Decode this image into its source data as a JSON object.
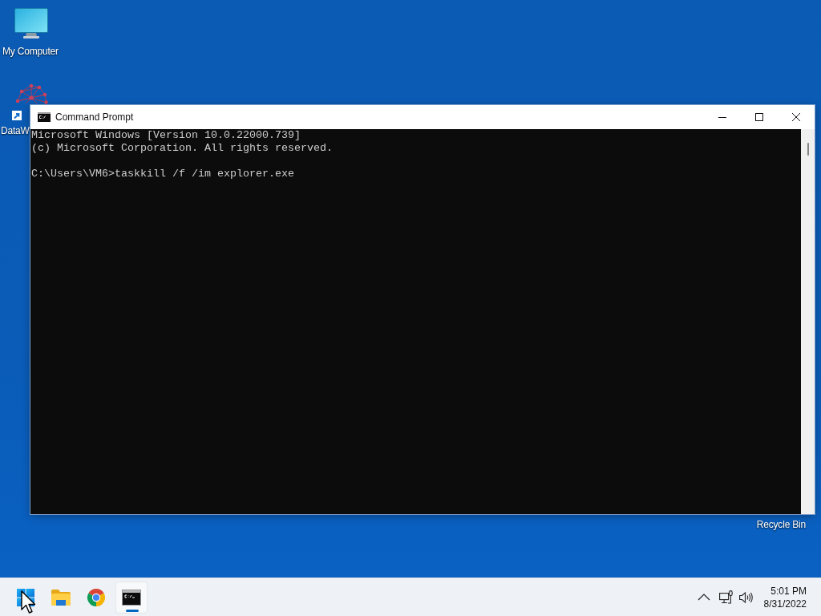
{
  "desktop": {
    "icons": [
      {
        "label": "My Computer",
        "kind": "computer",
        "shortcut": false
      },
      {
        "label": "DataW",
        "kind": "app",
        "shortcut": true
      }
    ],
    "recycle_bin": {
      "label": "Recycle Bin"
    }
  },
  "window": {
    "title": "Command Prompt",
    "console": {
      "output_lines": [
        "Microsoft Windows [Version 10.0.22000.739]",
        "(c) Microsoft Corporation. All rights reserved."
      ],
      "command_line": "C:\\Users\\VM6>taskkill /f /im explorer.exe"
    }
  },
  "taskbar": {
    "apps": [
      {
        "kind": "start",
        "active": false
      },
      {
        "kind": "folder",
        "active": false
      },
      {
        "kind": "browser",
        "active": false
      },
      {
        "kind": "terminal",
        "active": true
      }
    ],
    "clock": {
      "time": "5:01 PM",
      "date": "8/31/2022"
    }
  }
}
